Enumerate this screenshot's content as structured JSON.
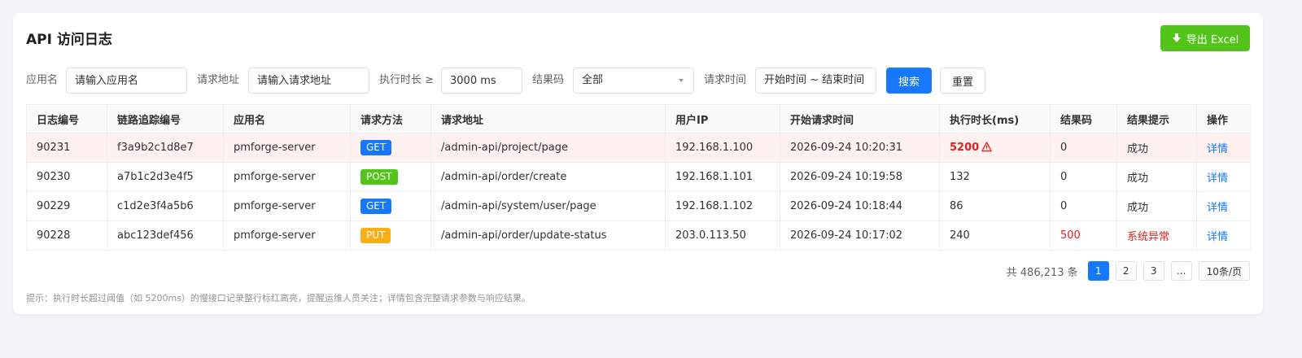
{
  "title": "API 访问日志",
  "export_label": "导出 Excel",
  "filters": {
    "app_label": "应用名",
    "app_placeholder": "请输入应用名",
    "url_label": "请求地址",
    "url_placeholder": "请输入请求地址",
    "duration_label": "执行时长 ≥",
    "duration_value": "3000 ms",
    "result_label": "结果码",
    "result_value": "全部",
    "time_label": "请求时间",
    "time_value": "开始时间 ~ 结束时间",
    "search_label": "搜索",
    "reset_label": "重置"
  },
  "columns": [
    "日志编号",
    "链路追踪编号",
    "应用名",
    "请求方法",
    "请求地址",
    "用户IP",
    "开始请求时间",
    "执行时长(ms)",
    "结果码",
    "结果提示",
    "操作"
  ],
  "rows": [
    {
      "id": "90231",
      "trace": "f3a9b2c1d8e7",
      "app": "pmforge-server",
      "method": "GET",
      "url": "/admin-api/project/page",
      "ip": "192.168.1.100",
      "time": "2026-09-24 10:20:31",
      "duration": "5200",
      "code": "0",
      "msg": "成功",
      "action": "详情"
    },
    {
      "id": "90230",
      "trace": "a7b1c2d3e4f5",
      "app": "pmforge-server",
      "method": "POST",
      "url": "/admin-api/order/create",
      "ip": "192.168.1.101",
      "time": "2026-09-24 10:19:58",
      "duration": "132",
      "code": "0",
      "msg": "成功",
      "action": "详情"
    },
    {
      "id": "90229",
      "trace": "c1d2e3f4a5b6",
      "app": "pmforge-server",
      "method": "GET",
      "url": "/admin-api/system/user/page",
      "ip": "192.168.1.102",
      "time": "2026-09-24 10:18:44",
      "duration": "86",
      "code": "0",
      "msg": "成功",
      "action": "详情"
    },
    {
      "id": "90228",
      "trace": "abc123def456",
      "app": "pmforge-server",
      "method": "PUT",
      "url": "/admin-api/order/update-status",
      "ip": "203.0.113.50",
      "time": "2026-09-24 10:17:02",
      "duration": "240",
      "code": "500",
      "msg": "系统异常",
      "action": "详情"
    }
  ],
  "method_colors": {
    "GET": "#1677ff",
    "POST": "#52c41a",
    "PUT": "#faad14"
  },
  "pagination": {
    "total": "共 486,213 条",
    "pages": [
      "1",
      "2",
      "3",
      "..."
    ],
    "page_size": "10条/页"
  },
  "hint": "提示：执行时长超过阈值（如 5200ms）的慢接口记录整行标红高亮，提醒运维人员关注；详情包含完整请求参数与响应结果。"
}
